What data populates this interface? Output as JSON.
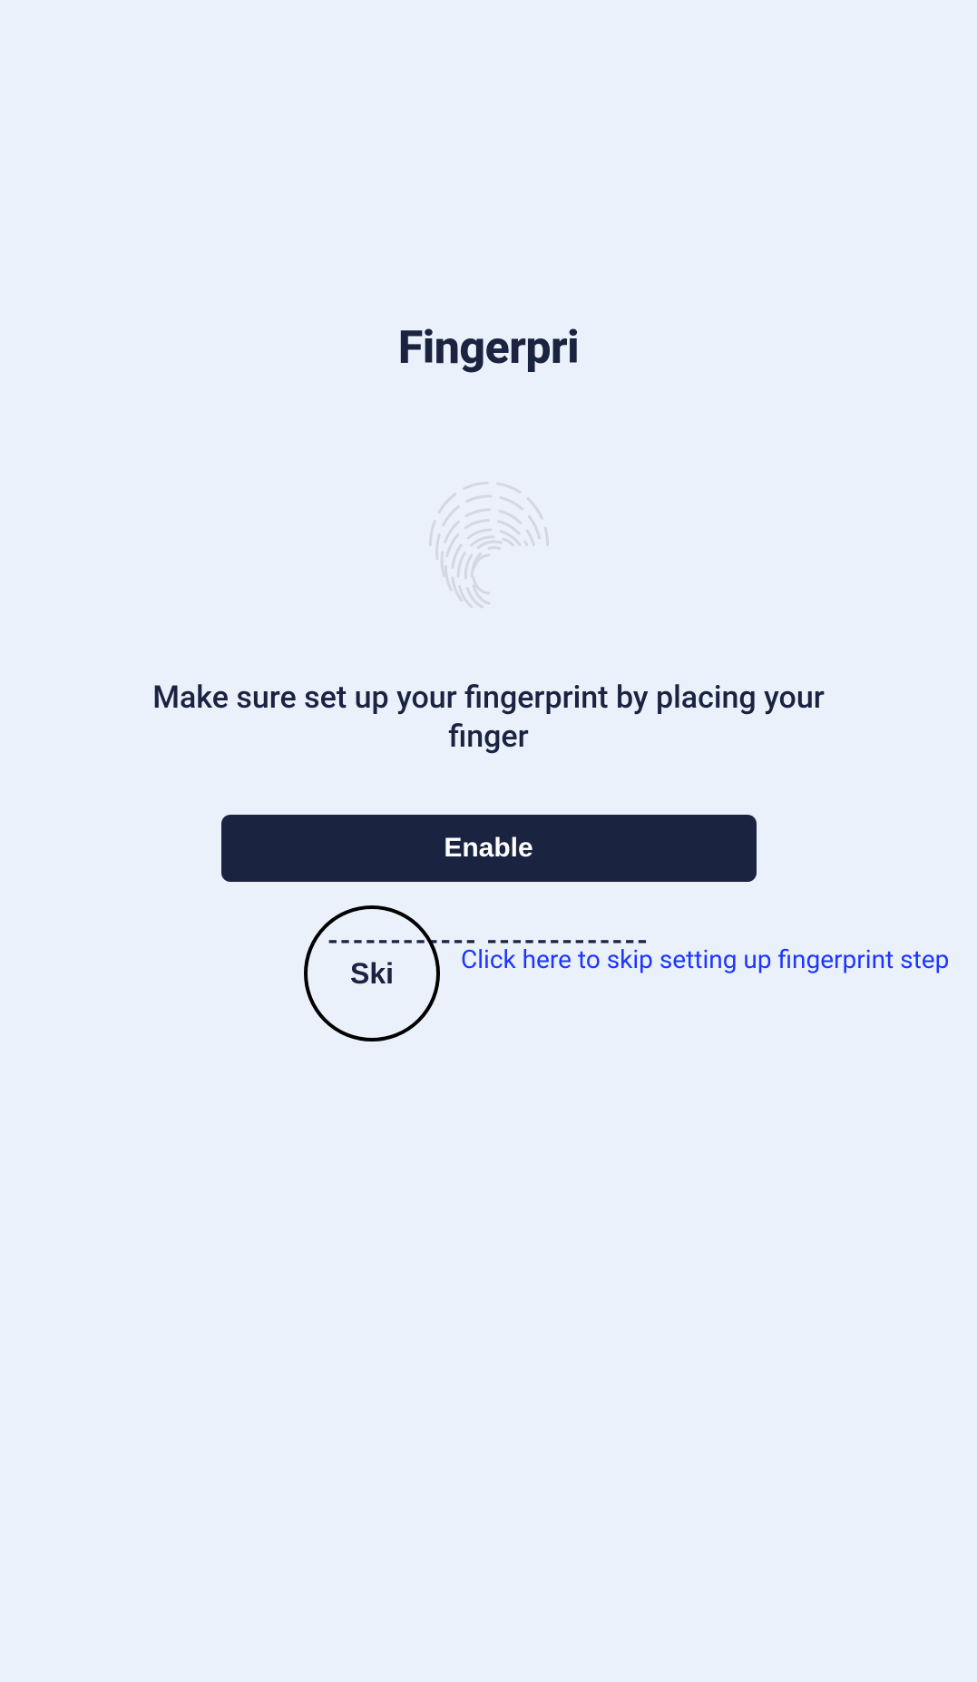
{
  "title": "Fingerpri",
  "instruction": "Make sure set up your fingerprint by placing your finger",
  "enable_label": "Enable",
  "divider_left": "------------",
  "divider_gap": "        ",
  "divider_right": "-------------",
  "skip_label": "Ski",
  "skip_hint": "Click here to skip setting up fingerprint step"
}
